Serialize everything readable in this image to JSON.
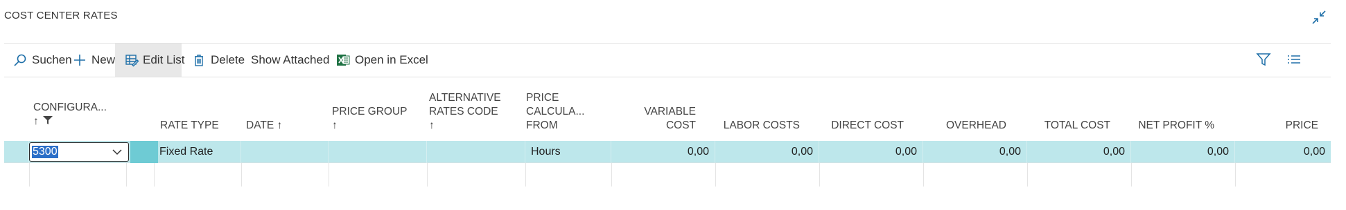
{
  "page": {
    "title": "COST CENTER RATES"
  },
  "toolbar": {
    "search_label": "Suchen",
    "new_label": "New",
    "edit_list_label": "Edit List",
    "delete_label": "Delete",
    "show_attached_label": "Show Attached",
    "open_excel_label": "Open in Excel"
  },
  "icons": {
    "search": "search-icon",
    "new": "plus-icon",
    "edit_list": "edit-list-icon",
    "delete": "trash-icon",
    "excel": "excel-icon",
    "filter": "filter-icon",
    "list": "list-icon",
    "collapse": "collapse-icon"
  },
  "colors": {
    "row_selected": "#bde7eb",
    "row_marker": "#6ecbd4",
    "accent": "#1e6fa8",
    "excel": "#1f7244"
  },
  "columns": {
    "configuration": {
      "line1": "CONFIGURA...",
      "line2": "↑"
    },
    "rate_type": "RATE TYPE",
    "date": "DATE ↑",
    "price_group": {
      "line1": "PRICE GROUP",
      "line2": "↑"
    },
    "alt_rates_code": {
      "line1": "ALTERNATIVE",
      "line2": "RATES CODE",
      "line3": "↑"
    },
    "price_calc_from": {
      "line1": "PRICE",
      "line2": "CALCULA...",
      "line3": "FROM"
    },
    "variable_cost": {
      "line1": "VARIABLE",
      "line2": "COST"
    },
    "labor_costs": "LABOR COSTS",
    "direct_cost": "DIRECT COST",
    "overhead": "OVERHEAD",
    "total_cost": "TOTAL COST",
    "net_profit": "NET PROFIT %",
    "price": "PRICE"
  },
  "rows": [
    {
      "configuration": "5300",
      "rate_type": "Fixed Rate",
      "date": "",
      "price_group": "",
      "alt_rates_code": "",
      "price_calc_from": "Hours",
      "variable_cost": "0,00",
      "labor_costs": "0,00",
      "direct_cost": "0,00",
      "overhead": "0,00",
      "total_cost": "0,00",
      "net_profit": "0,00",
      "price": "0,00"
    }
  ]
}
